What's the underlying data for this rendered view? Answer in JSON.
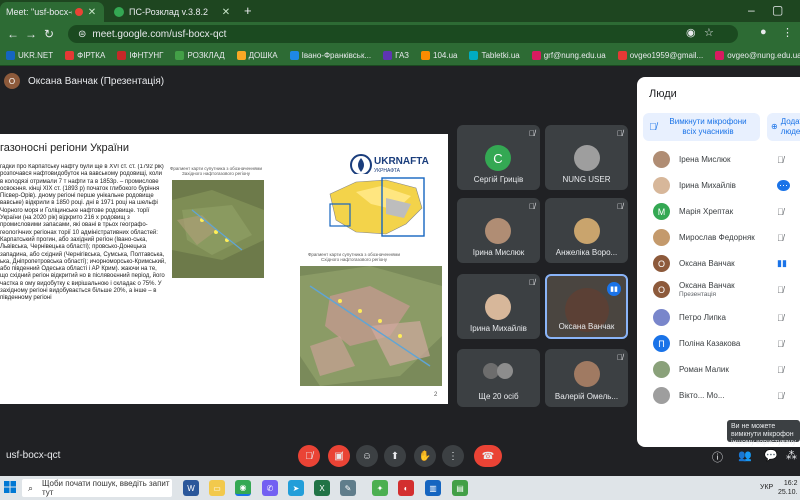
{
  "browser": {
    "tabs": [
      {
        "label": "Meet: \"usf-bocx-qct\"",
        "color": "#ea4335",
        "active": true
      },
      {
        "label": "ПС-Розклад v.3.8.2",
        "color": "#34a853",
        "active": false
      }
    ],
    "new_tab": "+",
    "url": "meet.google.com/usf-bocx-qct",
    "bookmarks": [
      {
        "label": "UKR.NET",
        "color": "#1565c0"
      },
      {
        "label": "ФІРТКА",
        "color": "#e53935"
      },
      {
        "label": "ІФНТУНГ",
        "color": "#c62828"
      },
      {
        "label": "РОЗКЛАД",
        "color": "#43a047"
      },
      {
        "label": "ДОШКА",
        "color": "#f9a825"
      },
      {
        "label": "Івано-Франківськ...",
        "color": "#1e88e5"
      },
      {
        "label": "ГАЗ",
        "color": "#5e35b1"
      },
      {
        "label": "104.ua",
        "color": "#fb8c00"
      },
      {
        "label": "Tabletki.ua",
        "color": "#00acc1"
      },
      {
        "label": "grf@nung.edu.ua",
        "color": "#d81b60"
      },
      {
        "label": "ovgeo1959@gmail...",
        "color": "#e53935"
      },
      {
        "label": "ovgeo@nung.edu.ua",
        "color": "#d81b60"
      }
    ]
  },
  "meet": {
    "presenter_label": "Оксана Ванчак (Презентація)",
    "presenter_initial": "О",
    "slide": {
      "title": "газоносні регіони України",
      "body": "гадки про Карпатську нафту були ще в XVI ст. ст. (1792 рік) розпочався нафтовидобуток на вавському родовищі, коли в колодязі отримали 7 т нафти та в 1853р. – промислове освоєння. кінці XIX ст. (1893 р) початок глибокого буріння Пісвер-Орів). дному регіоні перше унікальне родовище вавське) відкрили в 1850 році. дні в 1971 році на шельфі Чорного моря и Голіцинське нафтове родовище. торії України (на 2020 рік) відкрито 216 х родовищ з промисловими запасами, які овані в трьох географо-геологічних регіонах торії 10 адміністративних областей: Карпатський прогин, або західний регіон (Івано-ська, Львівська, Чернівецька області); провсько-Донецька западина, або східний (Чернігівська, Сумська, Полтавська, ька, Дніпропетровська області); ичорноморсько-Кримський, або південний Одеська області і АР Крим). жаючи на те, що східний регіон відкритий но в післявоєнний період, його частка в ому видобутку є вирішальною і складає о 75%. У західному регіоні видобувається більше 20%, а інше – в південному регіоні",
      "map1_caption": "Фрагмент карти супутника з обозначеннями Західного нафтогазового регіону",
      "map2_caption": "Фрагмент карти супутника з обозначеннями Східного нафтогазового регіону",
      "logo_title": "UKRNAFTA",
      "logo_subtitle": "УКРНАФТА",
      "page_number": "2"
    },
    "tiles": [
      {
        "name": "Сергій Гриців",
        "initial": "С",
        "color": "#34a853"
      },
      {
        "name": "NUNG USER",
        "initial": "",
        "color": "#9e9e9e"
      },
      {
        "name": "Ірина Мислюк",
        "initial": "",
        "color": "#b08d74"
      },
      {
        "name": "Анжеліка Воро...",
        "initial": "",
        "color": "#c9a46d"
      },
      {
        "name": "Ірина Михайлів",
        "initial": "",
        "color": "#d7b79a"
      },
      {
        "name": "Оксана Ванчак",
        "initial": "",
        "color": "#5b4035"
      },
      {
        "name": "Ще 20 осіб",
        "initial": "",
        "color": "#6d6d6d"
      },
      {
        "name": "Валерій Омель...",
        "initial": "",
        "color": "#a07a62"
      }
    ],
    "meeting_code": "usf-bocx-qct"
  },
  "people_panel": {
    "title": "Люди",
    "mute_all": "Вимкнути мікрофони всіх учасників",
    "add_people": "Додати людей",
    "participants": [
      {
        "name": "Ірена Мислюк",
        "sub": "",
        "initial": "",
        "color": "#b08d74"
      },
      {
        "name": "Ірина Михайлів",
        "sub": "",
        "initial": "",
        "color": "#d7b79a"
      },
      {
        "name": "Марія Хрептак",
        "sub": "",
        "initial": "М",
        "color": "#34a853"
      },
      {
        "name": "Мирослав Федорняк",
        "sub": "",
        "initial": "",
        "color": "#c49a6c"
      },
      {
        "name": "Оксана Ванчак",
        "sub": "",
        "initial": "О",
        "color": "#8d5a3b"
      },
      {
        "name": "Оксана Ванчак",
        "sub": "Презентація",
        "initial": "О",
        "color": "#8d5a3b"
      },
      {
        "name": "Петро Липка",
        "sub": "",
        "initial": "",
        "color": "#7986cb"
      },
      {
        "name": "Поліна Казакова",
        "sub": "",
        "initial": "П",
        "color": "#1a73e8"
      },
      {
        "name": "Роман Малик",
        "sub": "",
        "initial": "",
        "color": "#8aa17a"
      },
      {
        "name": "Вікто... Мо...",
        "sub": "",
        "initial": "",
        "color": "#9e9e9e"
      }
    ]
  },
  "tooltip": "Ви не можете вимкнути мікрофон іншому користувачу",
  "taskbar": {
    "search_placeholder": "Щоби почати пошук, введіть запит тут",
    "language": "УКР",
    "time": "16:2",
    "date": "25.10."
  }
}
